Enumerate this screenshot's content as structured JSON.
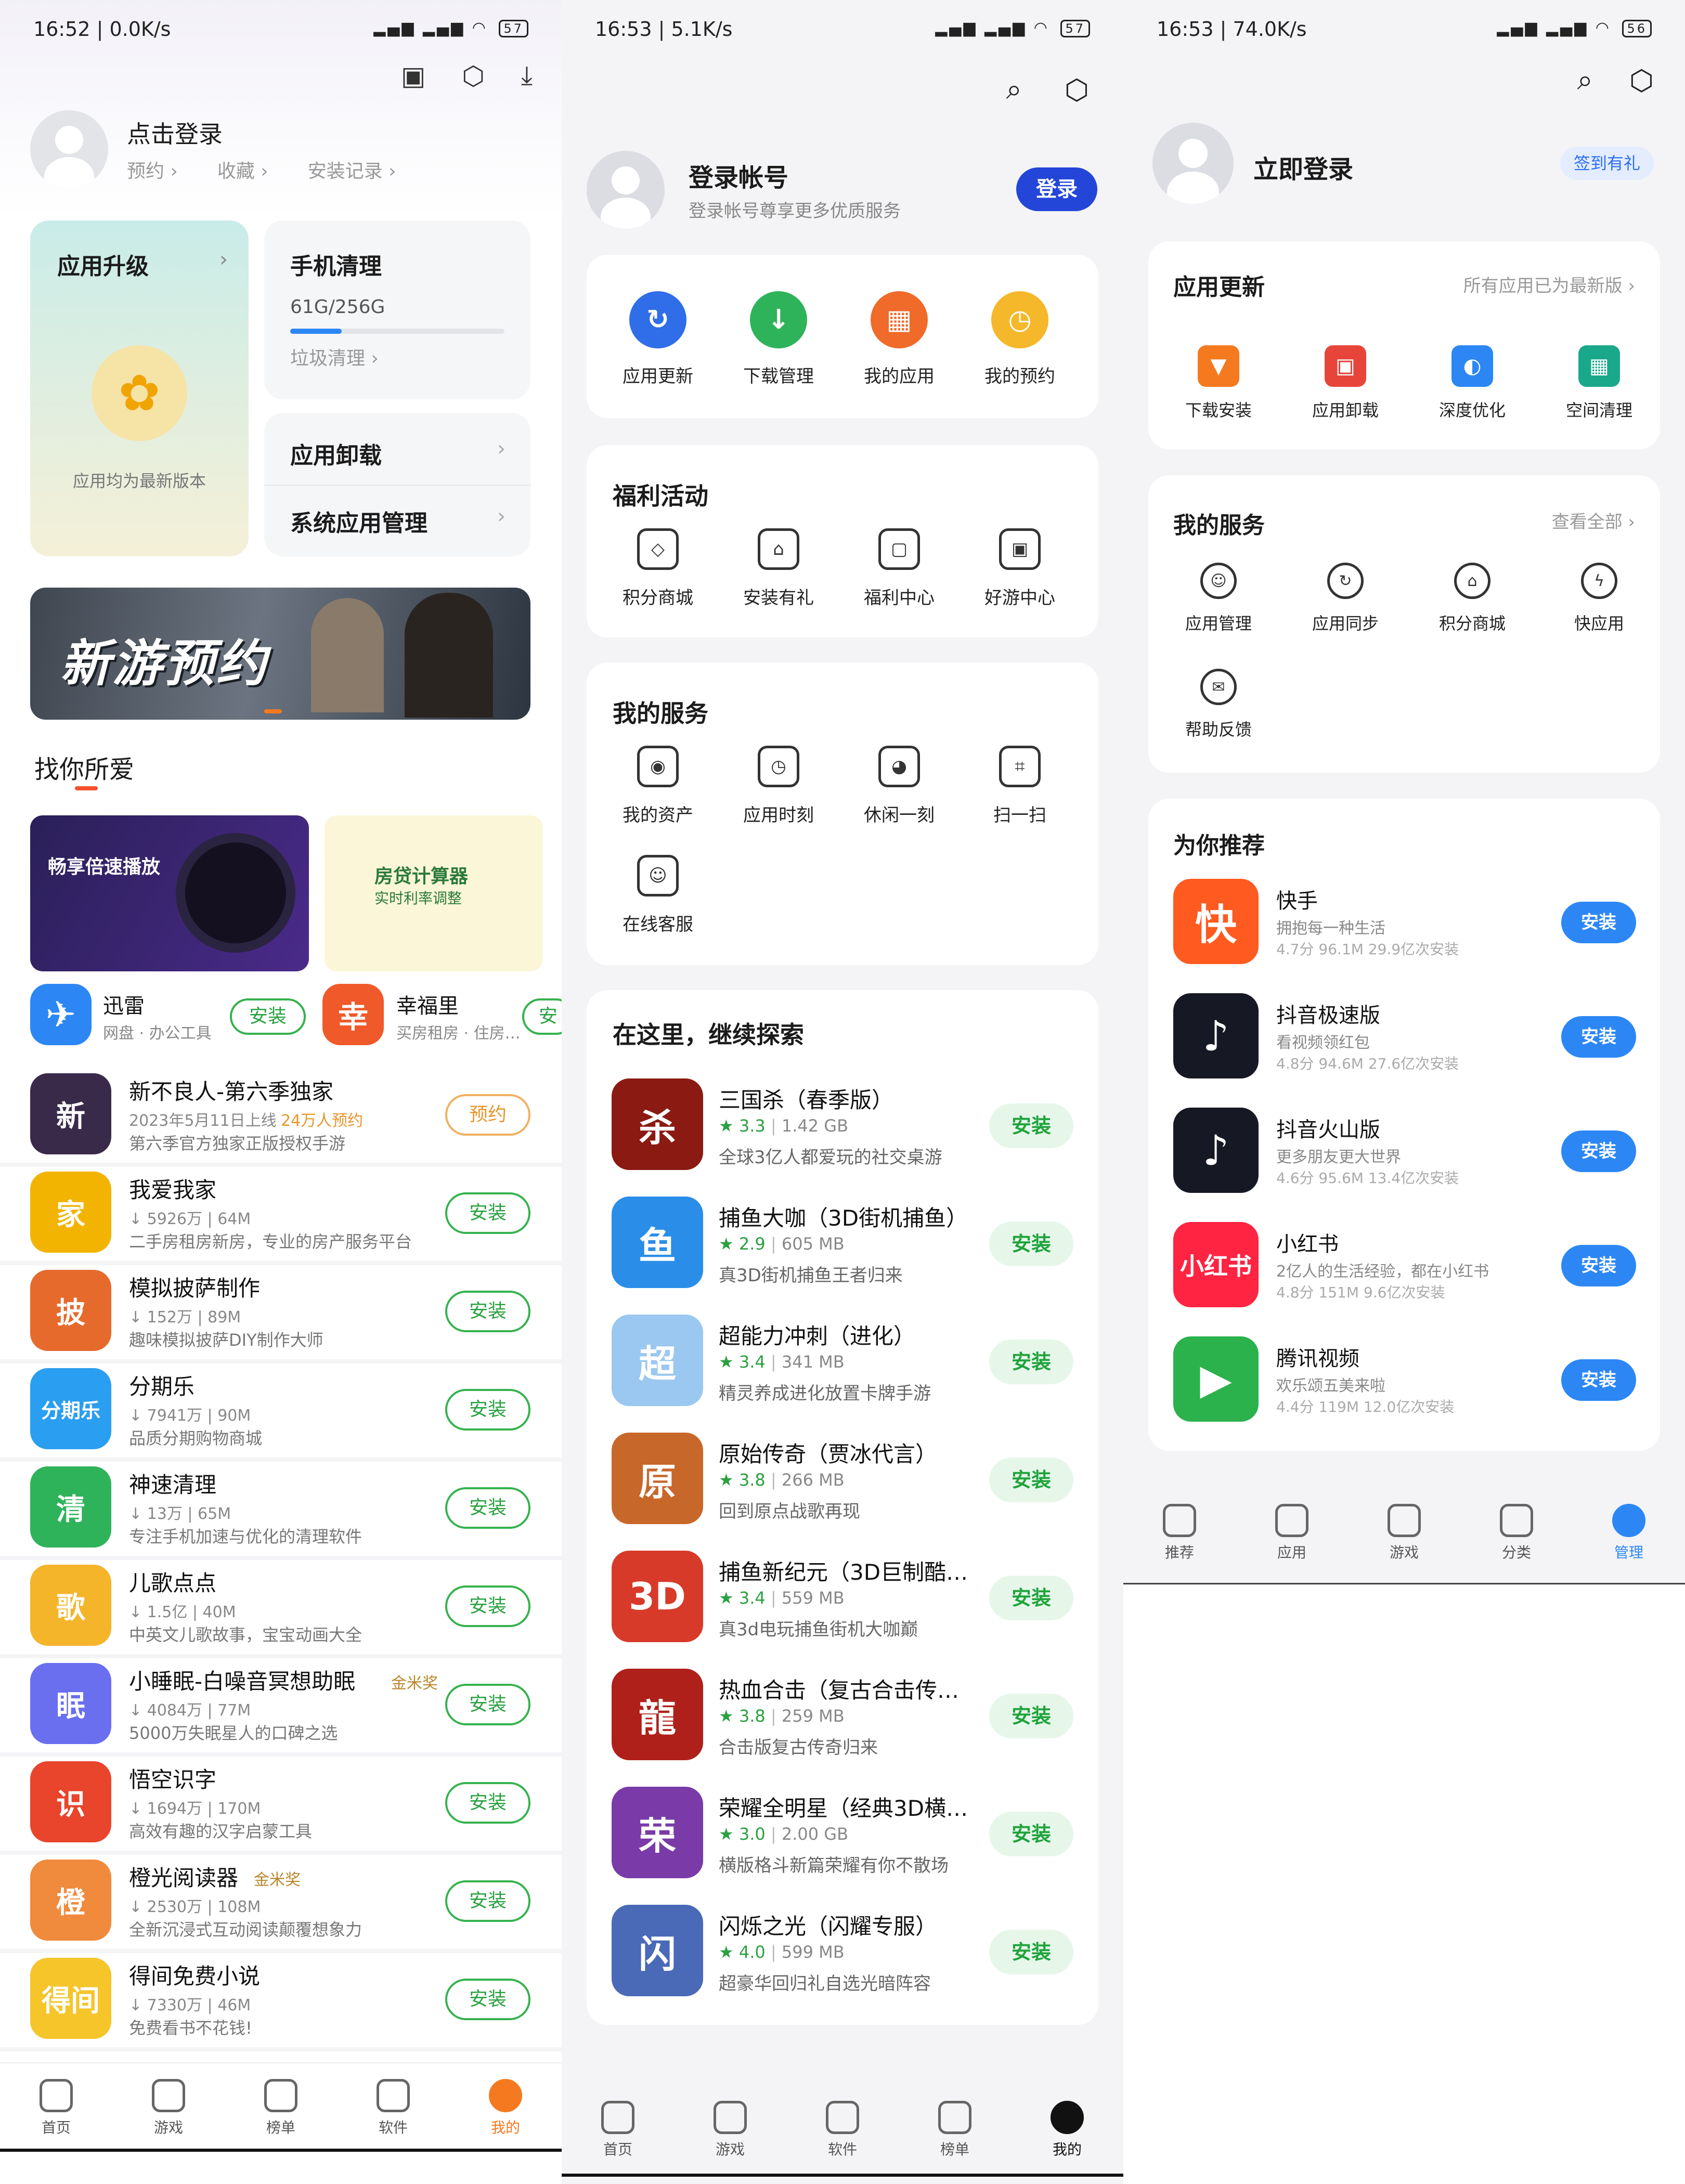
{
  "p1": {
    "status": {
      "time": "16:52 | 0.0K/s",
      "battery": "57"
    },
    "login": {
      "title": "点击登录",
      "links": [
        "预约 ›",
        "收藏 ›",
        "安装记录 ›"
      ]
    },
    "upgrade": {
      "title": "应用升级",
      "chev": "›",
      "note": "应用均为最新版本"
    },
    "clean": {
      "title": "手机清理",
      "storage": "61G/256G",
      "storage_fraction": 0.24,
      "link": "垃圾清理 ›"
    },
    "uninstall": {
      "title": "应用卸载",
      "chev": "›"
    },
    "sysapp": {
      "title": "系统应用管理",
      "chev": "›"
    },
    "banner": {
      "text": "新游预约"
    },
    "section": "找你所爱",
    "promo": [
      {
        "title": "畅享倍速播放",
        "name": "迅雷",
        "sub": "网盘 · 办公工具",
        "btn": "安装",
        "icon_text": "✈"
      },
      {
        "title": "房贷计算器",
        "subtitle": "实时利率调整",
        "name": "幸福里",
        "sub": "买房租房 · 住房…",
        "btn": "安",
        "icon_text": "幸"
      }
    ],
    "apps": [
      {
        "name": "新不良人-第六季独家",
        "sub": "2023年5月11日上线",
        "hot": "24万人预约",
        "desc": "第六季官方独家正版授权手游",
        "btn": "预约",
        "icon_text": "新",
        "color": "#3a2a4a"
      },
      {
        "name": "我爱我家",
        "sub": "↓ 5926万 | 64M",
        "desc": "二手房租房新房，专业的房产服务平台",
        "btn": "安装",
        "icon_text": "家",
        "color": "#f2b400"
      },
      {
        "name": "模拟披萨制作",
        "sub": "↓ 152万 | 89M",
        "desc": "趣味模拟披萨DIY制作大师",
        "btn": "安装",
        "icon_text": "披",
        "color": "#e66a2c"
      },
      {
        "name": "分期乐",
        "sub": "↓ 7941万 | 90M",
        "desc": "品质分期购物商城",
        "btn": "安装",
        "icon_text": "分期乐",
        "color": "#2a9ef0"
      },
      {
        "name": "神速清理",
        "sub": "↓ 13万 | 65M",
        "desc": "专注手机加速与优化的清理软件",
        "btn": "安装",
        "icon_text": "清",
        "color": "#2eb35a"
      },
      {
        "name": "儿歌点点",
        "sub": "↓ 1.5亿 | 40M",
        "desc": "中英文儿歌故事，宝宝动画大全",
        "btn": "安装",
        "icon_text": "歌",
        "color": "#f4b52a"
      },
      {
        "name": "小睡眠-白噪音冥想助眠",
        "badge": "金米奖",
        "sub": "↓ 4084万 | 77M",
        "desc": "5000万失眠星人的口碑之选",
        "btn": "安装",
        "icon_text": "眠",
        "color": "#6a6ff0"
      },
      {
        "name": "悟空识字",
        "sub": "↓ 1694万 | 170M",
        "desc": "高效有趣的汉字启蒙工具",
        "btn": "安装",
        "icon_text": "识",
        "color": "#e8452c"
      },
      {
        "name": "橙光阅读器",
        "badge": "金米奖",
        "sub": "↓ 2530万 | 108M",
        "desc": "全新沉浸式互动阅读颠覆想象力",
        "btn": "安装",
        "icon_text": "橙",
        "color": "#f08a3c"
      },
      {
        "name": "得间免费小说",
        "sub": "↓ 7330万 | 46M",
        "desc": "免费看书不花钱!",
        "btn": "安装",
        "icon_text": "得间",
        "color": "#f5c52a"
      }
    ],
    "nav": [
      {
        "label": "首页",
        "icon": "home-icon"
      },
      {
        "label": "游戏",
        "icon": "game-icon"
      },
      {
        "label": "榜单",
        "icon": "star-icon"
      },
      {
        "label": "软件",
        "icon": "software-icon"
      },
      {
        "label": "我的",
        "icon": "profile-icon",
        "active": true
      }
    ],
    "accent": "#f57a1f"
  },
  "p2": {
    "status": {
      "time": "16:53 | 5.1K/s",
      "battery": "57"
    },
    "login": {
      "title": "登录帐号",
      "sub": "登录帐号尊享更多优质服务",
      "btn": "登录"
    },
    "quick": [
      {
        "label": "应用更新",
        "color": "#2f6ee8",
        "glyph": "↻"
      },
      {
        "label": "下载管理",
        "color": "#2eb35a",
        "glyph": "↓"
      },
      {
        "label": "我的应用",
        "color": "#f06a2a",
        "glyph": "▦"
      },
      {
        "label": "我的预约",
        "color": "#f5b82a",
        "glyph": "◷"
      }
    ],
    "welfare": {
      "title": "福利活动",
      "items": [
        {
          "label": "积分商城",
          "glyph": "◇"
        },
        {
          "label": "安装有礼",
          "glyph": "⌂"
        },
        {
          "label": "福利中心",
          "glyph": "▢"
        },
        {
          "label": "好游中心",
          "glyph": "▣"
        }
      ]
    },
    "services": {
      "title": "我的服务",
      "items": [
        {
          "label": "我的资产",
          "glyph": "◉"
        },
        {
          "label": "应用时刻",
          "glyph": "◷"
        },
        {
          "label": "休闲一刻",
          "glyph": "◕"
        },
        {
          "label": "扫一扫",
          "glyph": "⌗"
        },
        {
          "label": "在线客服",
          "glyph": "☺"
        }
      ]
    },
    "explore": {
      "title": "在这里，继续探索",
      "btn": "安装",
      "games": [
        {
          "name": "三国杀（春季版）",
          "rating": "★ 3.3",
          "size": "1.42 GB",
          "desc": "全球3亿人都爱玩的社交桌游",
          "icon_text": "杀",
          "color": "#8a1a12"
        },
        {
          "name": "捕鱼大咖（3D街机捕鱼）",
          "rating": "★ 2.9",
          "size": "605 MB",
          "desc": "真3D街机捕鱼王者归来",
          "icon_text": "鱼",
          "color": "#2a8ee8"
        },
        {
          "name": "超能力冲刺（进化）",
          "rating": "★ 3.4",
          "size": "341 MB",
          "desc": "精灵养成进化放置卡牌手游",
          "icon_text": "超",
          "color": "#9ac8f0"
        },
        {
          "name": "原始传奇（贾冰代言）",
          "rating": "★ 3.8",
          "size": "266 MB",
          "desc": "回到原点战歌再现",
          "icon_text": "原",
          "color": "#c8672a"
        },
        {
          "name": "捕鱼新纪元（3D巨制酷…",
          "rating": "★ 3.4",
          "size": "559 MB",
          "desc": "真3d电玩捕鱼街机大咖巅",
          "icon_text": "3D",
          "color": "#d83a2a"
        },
        {
          "name": "热血合击（复古合击传…",
          "rating": "★ 3.8",
          "size": "259 MB",
          "desc": "合击版复古传奇归来",
          "icon_text": "龍",
          "color": "#b0201a"
        },
        {
          "name": "荣耀全明星（经典3D横…",
          "rating": "★ 3.0",
          "size": "2.00 GB",
          "desc": "横版格斗新篇荣耀有你不散场",
          "icon_text": "荣",
          "color": "#7a3aa8"
        },
        {
          "name": "闪烁之光（闪耀专服）",
          "rating": "★ 4.0",
          "size": "599 MB",
          "desc": "超豪华回归礼自选光暗阵容",
          "icon_text": "闪",
          "color": "#4a6ab8"
        }
      ]
    },
    "nav": [
      {
        "label": "首页",
        "icon": "home-icon"
      },
      {
        "label": "游戏",
        "icon": "game-icon"
      },
      {
        "label": "软件",
        "icon": "software-icon"
      },
      {
        "label": "榜单",
        "icon": "crown-icon"
      },
      {
        "label": "我的",
        "icon": "profile-icon",
        "active": true
      }
    ]
  },
  "p3": {
    "status": {
      "time": "16:53 | 74.0K/s",
      "battery": "56"
    },
    "login": {
      "title": "立即登录",
      "badge": "签到有礼"
    },
    "update": {
      "title": "应用更新",
      "note": "所有应用已为最新版",
      "items": [
        {
          "label": "下载安装",
          "color": "#f57a1f",
          "glyph": "▼"
        },
        {
          "label": "应用卸载",
          "color": "#e8453a",
          "glyph": "▣"
        },
        {
          "label": "深度优化",
          "color": "#2c87f5",
          "glyph": "◐"
        },
        {
          "label": "空间清理",
          "color": "#1aa88a",
          "glyph": "▦"
        }
      ]
    },
    "services": {
      "title": "我的服务",
      "more": "查看全部",
      "items": [
        {
          "label": "应用管理",
          "glyph": "☺"
        },
        {
          "label": "应用同步",
          "glyph": "↻"
        },
        {
          "label": "积分商城",
          "glyph": "⌂"
        },
        {
          "label": "快应用",
          "glyph": "ϟ"
        },
        {
          "label": "帮助反馈",
          "glyph": "✉"
        }
      ]
    },
    "recommend": {
      "title": "为你推荐",
      "btn": "安装",
      "apps": [
        {
          "name": "快手",
          "desc": "拥抱每一种生活",
          "meta": "4.7分 96.1M 29.9亿次安装",
          "icon_text": "快",
          "color": "#ff5a1f"
        },
        {
          "name": "抖音极速版",
          "desc": "看视频领红包",
          "meta": "4.8分 94.6M 27.6亿次安装",
          "icon_text": "♪",
          "color": "#161823"
        },
        {
          "name": "抖音火山版",
          "desc": "更多朋友更大世界",
          "meta": "4.6分 95.6M 13.4亿次安装",
          "icon_text": "♪",
          "color": "#161823"
        },
        {
          "name": "小红书",
          "desc": "2亿人的生活经验，都在小红书",
          "meta": "4.8分 151M 9.6亿次安装",
          "icon_text": "小红书",
          "color": "#ff2442"
        },
        {
          "name": "腾讯视频",
          "desc": "欢乐颂五美来啦",
          "meta": "4.4分 119M 12.0亿次安装",
          "icon_text": "▶",
          "color": "#2bb24c"
        }
      ]
    },
    "nav": [
      {
        "label": "推荐",
        "icon": "recommend-icon"
      },
      {
        "label": "应用",
        "icon": "app-icon"
      },
      {
        "label": "游戏",
        "icon": "game-icon"
      },
      {
        "label": "分类",
        "icon": "category-icon"
      },
      {
        "label": "管理",
        "icon": "manage-icon",
        "active": true
      }
    ],
    "accent": "#2c87f5"
  }
}
